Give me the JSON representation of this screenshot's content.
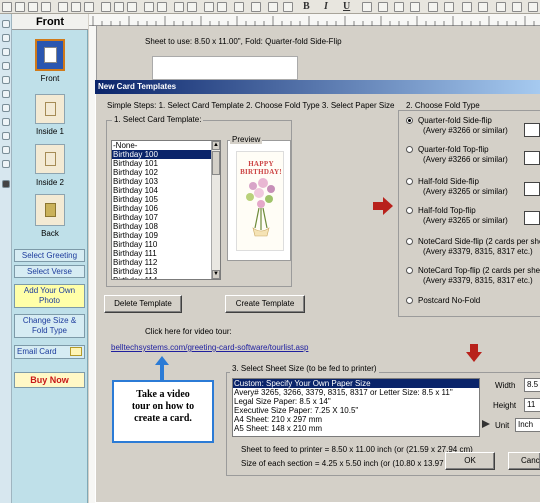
{
  "toolbar": {
    "icons": [
      "save-icon",
      "cut-icon",
      "copy-icon",
      "paste-icon",
      "undo-icon",
      "redo-icon",
      "delete-icon",
      "print-preview-icon",
      "print-icon",
      "open-icon",
      "image-icon",
      "zoom-out-icon",
      "zoom-in-icon",
      "grid-icon",
      "color-icon",
      "fill-icon"
    ],
    "bold": "B",
    "italic": "I",
    "underline": "U"
  },
  "panel": {
    "title": "Front",
    "pages": [
      {
        "label": "Front"
      },
      {
        "label": "Inside 1"
      },
      {
        "label": "Inside 2"
      },
      {
        "label": "Back"
      }
    ],
    "select_greeting": "Select Greeting",
    "select_verse": "Select Verse",
    "add_photo": "Add Your Own Photo",
    "change_size": "Change Size & Fold Type",
    "email_card": "Email Card",
    "buy_now": "Buy Now"
  },
  "workspace": {
    "sheet_info": "Sheet to use: 8.50 x 11.00\", Fold: Quarter-fold Side-Flip"
  },
  "dialog": {
    "title": "New Card Templates",
    "steps": "Simple Steps: 1. Select Card Template  2. Choose Fold Type  3. Select Paper Size",
    "group1_label": "1. Select Card Template:",
    "preview_label": "Preview",
    "preview_card_text": "HAPPY BIRTHDAY!",
    "templates": [
      "-None-",
      "Birthday 100",
      "Birthday 101",
      "Birthday 102",
      "Birthday 103",
      "Birthday 104",
      "Birthday 105",
      "Birthday 106",
      "Birthday 107",
      "Birthday 108",
      "Birthday 109",
      "Birthday 110",
      "Birthday 111",
      "Birthday 112",
      "Birthday 113",
      "Birthday 114"
    ],
    "selected_template": "Birthday 100",
    "delete_button": "Delete Template",
    "create_button": "Create Template",
    "group2_label": "2. Choose Fold Type",
    "fold_types": [
      {
        "line1": "Quarter-fold Side-flip",
        "line2": "(Avery #3266 or similar)",
        "selected": true
      },
      {
        "line1": "Quarter-fold Top-flip",
        "line2": "(Avery #3266 or similar)",
        "selected": false
      },
      {
        "line1": "Half-fold Side-flip",
        "line2": "(Avery #3265 or similar)",
        "selected": false
      },
      {
        "line1": "Half-fold Top-flip",
        "line2": "(Avery #3265 or similar)",
        "selected": false
      },
      {
        "line1": "NoteCard Side-flip (2 cards per she",
        "line2": "(Avery #3379, 8315, 8317 etc.)",
        "selected": false
      },
      {
        "line1": "NoteCard Top-flip (2 cards per she",
        "line2": "(Avery #3379, 8315, 8317 etc.)",
        "selected": false
      },
      {
        "line1": "Postcard No-Fold",
        "line2": "",
        "selected": false
      }
    ],
    "video_click": "Click here for video tour:",
    "video_link": "belltechsystems.com/greeting-card-software/tourlist.asp",
    "video_callout": "Take a video tour on how to create a card.",
    "group3_label": "3. Select Sheet Size (to be fed to printer)",
    "sheet_sizes": [
      "Custom: Specify Your Own Paper Size",
      "Avery# 3265, 3266, 3379, 8315, 8317 or Letter Size: 8.5 x 11\"",
      "Legal Size Paper: 8.5 x 14\"",
      "Executive Size Paper: 7.25  X 10.5\"",
      "A4 Sheet: 210 x 297 mm",
      "A5 Sheet: 148 x 210 mm"
    ],
    "width_label": "Width",
    "width_value": "8.5",
    "height_label": "Height",
    "height_value": "11",
    "unit_label": "Unit",
    "unit_value": "Inch",
    "feed_info": "Sheet to feed to printer = 8.50 x 11.00 inch (or (21.59 x 27.94 cm)",
    "section_info": "Size of each section = 4.25 x 5.50 inch (or (10.80 x 13.97 cm)",
    "ok": "OK",
    "cancel": "Canc"
  },
  "colors": {
    "accent_red": "#b8211b",
    "link_blue": "#1f1f9f",
    "title_bar": "#0a246a",
    "panel_bg": "#bfe0e9",
    "callout_border": "#2b7bd6"
  }
}
